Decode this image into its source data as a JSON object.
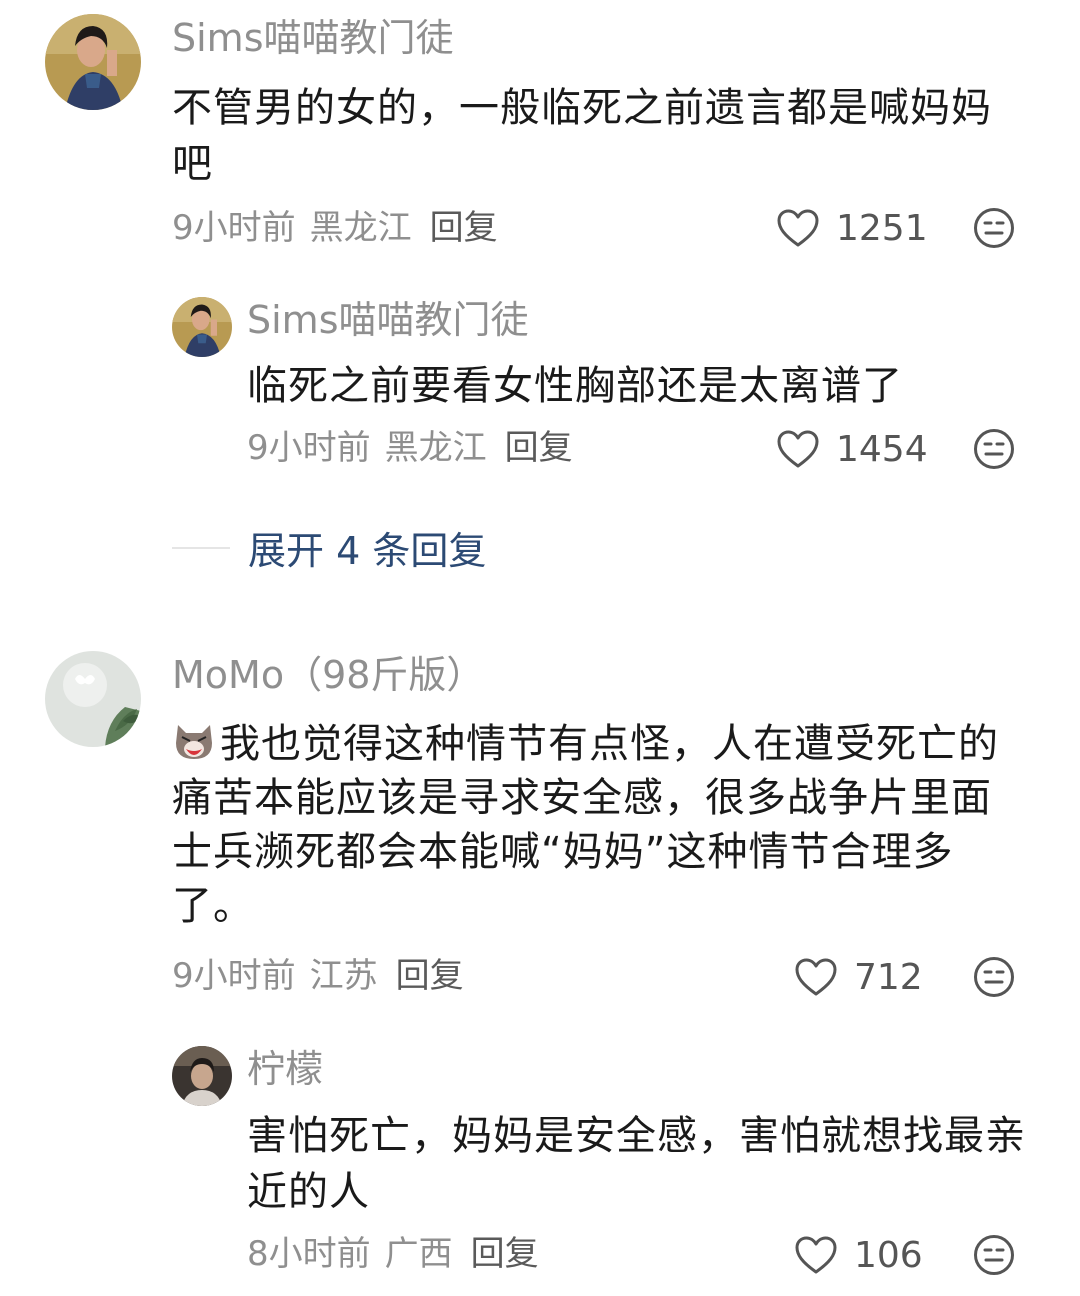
{
  "comments": [
    {
      "user": "Sims喵喵教门徒",
      "text": "不管男的女的，一般临死之前遗言都是喊妈妈吧",
      "time": "9小时前",
      "location": "黑龙江",
      "reply_label": "回复",
      "likes": "1251",
      "avatar": "woman-portrait-avatar",
      "replies": [
        {
          "user": "Sims喵喵教门徒",
          "text": "临死之前要看女性胸部还是太离谱了",
          "time": "9小时前",
          "location": "黑龙江",
          "reply_label": "回复",
          "likes": "1454"
        }
      ],
      "expand_label": "展开 4 条回复"
    },
    {
      "user": "MoMo（98斤版）",
      "text": "我也觉得这种情节有点怪，人在遭受死亡的痛苦本能应该是寻求安全感，很多战争片里面士兵濒死都会本能喊“妈妈”这种情节合理多了。",
      "emoji": "crying-cat-emoji",
      "time": "9小时前",
      "location": "江苏",
      "reply_label": "回复",
      "likes": "712",
      "replies": [
        {
          "user": "柠檬",
          "text": "害怕死亡，妈妈是安全感，害怕就想找最亲近的人",
          "time": "8小时前",
          "location": "广西",
          "reply_label": "回复",
          "likes": "106"
        }
      ]
    }
  ],
  "icons": {
    "like": "heart-outline-icon",
    "dislike": "meh-face-icon"
  },
  "colors": {
    "username": "#8f8f8f",
    "body_text": "#1a1a1a",
    "expand_link": "#2c4a74"
  }
}
